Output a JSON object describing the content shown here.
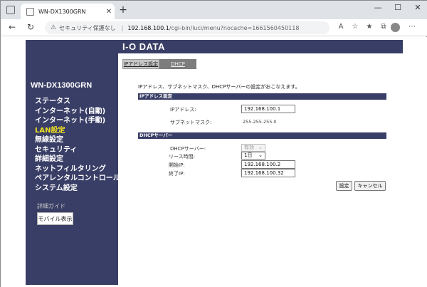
{
  "browser": {
    "tab_title": "WN-DX1300GRN",
    "tab_close": "✕",
    "new_tab": "+",
    "security_label": "セキュリティ保護なし",
    "url_host": "192.168.100.1",
    "url_path": "/cgi-bin/luci/menu?nocache=1661560450118",
    "window_controls": [
      "—",
      "☐",
      "✕"
    ]
  },
  "logo": "I-O DATA",
  "sidebar": {
    "model": "WN-DX1300GRN",
    "menu": [
      {
        "label": "ステータス",
        "active": false
      },
      {
        "label": "インターネット(自動)",
        "active": false
      },
      {
        "label": "インターネット(手動)",
        "active": false
      },
      {
        "label": "LAN設定",
        "active": true
      },
      {
        "label": "無線設定",
        "active": false
      },
      {
        "label": "セキュリティ",
        "active": false
      },
      {
        "label": "詳細設定",
        "active": false
      },
      {
        "label": "ネットフィルタリング",
        "active": false
      },
      {
        "label": "ペアレンタルコントロール",
        "active": false
      },
      {
        "label": "システム設定",
        "active": false
      }
    ],
    "guide_label": "詳細ガイド",
    "mobile_button": "モバイル表示"
  },
  "tabs": [
    {
      "label": "IPアドレス設定",
      "active": true
    },
    {
      "label": "DHCP",
      "active": false
    }
  ],
  "description": "IPアドレス、サブネットマスク、DHCPサーバーの設定がおこなえます。",
  "ip_section": {
    "heading": "IPアドレス設定",
    "ip_label": "IPアドレス:",
    "ip_value": "192.168.100.1",
    "mask_label": "サブネットマスク:",
    "mask_value": "255.255.255.0"
  },
  "dhcp_section": {
    "heading": "DHCPサーバー",
    "server_label": "DHCPサーバー:",
    "server_value": "有効",
    "lease_label": "リース時間:",
    "lease_value": "1日",
    "start_label": "開始IP:",
    "start_value": "192.168.100.2",
    "end_label": "終了IP:",
    "end_value": "192.168.100.32"
  },
  "buttons": {
    "apply": "設定",
    "cancel": "キャンセル"
  },
  "colors": {
    "brand_navy": "#393e66",
    "active_menu": "#f0e020"
  }
}
